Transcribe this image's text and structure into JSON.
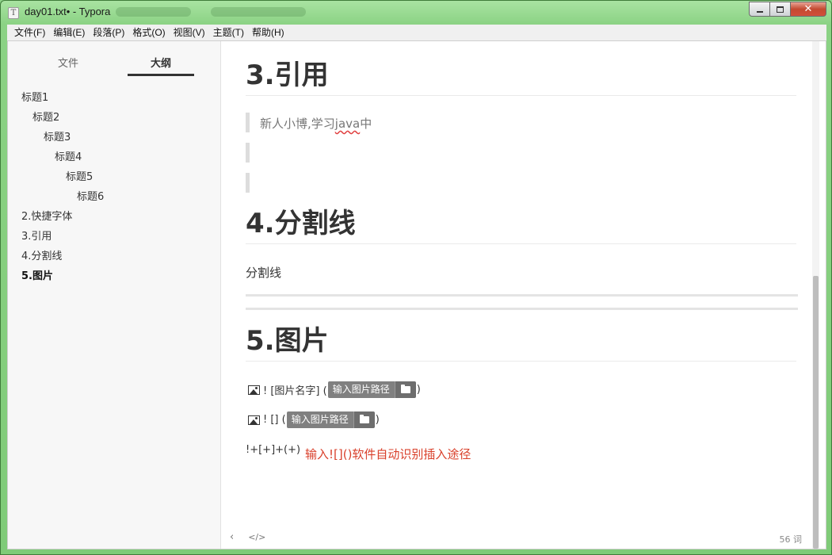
{
  "window": {
    "title": "day01.txt• - Typora",
    "app_icon": "T"
  },
  "menu": [
    {
      "label": "文件(F)"
    },
    {
      "label": "编辑(E)"
    },
    {
      "label": "段落(P)"
    },
    {
      "label": "格式(O)"
    },
    {
      "label": "视图(V)"
    },
    {
      "label": "主题(T)"
    },
    {
      "label": "帮助(H)"
    }
  ],
  "sidebar": {
    "tabs": {
      "files": "文件",
      "outline": "大纲"
    },
    "outline": [
      {
        "label": "标题1",
        "level": 1
      },
      {
        "label": "标题2",
        "level": 2
      },
      {
        "label": "标题3",
        "level": 3
      },
      {
        "label": "标题4",
        "level": 4
      },
      {
        "label": "标题5",
        "level": 5
      },
      {
        "label": "标题6",
        "level": 6
      },
      {
        "label": "2.快捷字体",
        "level": 1
      },
      {
        "label": "3.引用",
        "level": 1
      },
      {
        "label": "4.分割线",
        "level": 1
      },
      {
        "label": "5.图片",
        "level": 1,
        "active": true
      }
    ]
  },
  "editor": {
    "section3_heading": "3.引用",
    "quote_text_before": "新人小博,学习",
    "quote_text_spell": "java",
    "quote_text_after": "中",
    "section4_heading": "4.分割线",
    "divider_para": "分割线",
    "section5_heading": "5.图片",
    "img1_prefix": "! [图片名字] (",
    "img1_placeholder": "输入图片路径",
    "img1_suffix": ")",
    "img2_prefix": "! [] (",
    "img2_placeholder": "输入图片路径",
    "img2_suffix": ")",
    "syntax_line": "!+[+]+(+)",
    "red_note": "输入![]()软件自动识别插入途径"
  },
  "footer": {
    "back_glyph": "‹",
    "source_glyph": "</>",
    "word_count": "56 词"
  },
  "colors": {
    "window_frame": "#8bd284",
    "accent_red": "#d9402b"
  }
}
